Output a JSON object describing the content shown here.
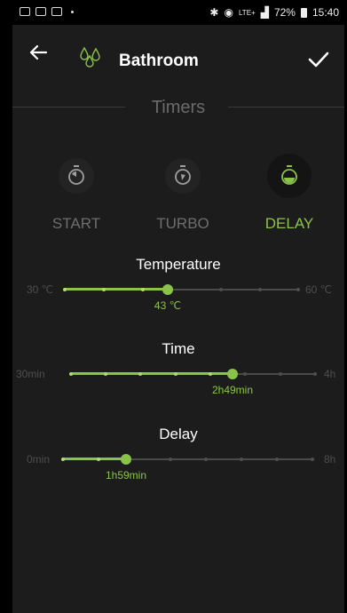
{
  "status_bar": {
    "signal_label": "LTE+",
    "battery": "72%",
    "time": "15:40"
  },
  "app_bar": {
    "title": "Bathroom"
  },
  "section": {
    "title": "Timers"
  },
  "modes": [
    {
      "label": "START",
      "active": false
    },
    {
      "label": "TURBO",
      "active": false
    },
    {
      "label": "DELAY",
      "active": true
    }
  ],
  "sliders": {
    "temperature": {
      "title": "Temperature",
      "min_label": "30 ℃",
      "max_label": "60 ℃",
      "value_label": "43 ℃",
      "level": 0.43
    },
    "time": {
      "title": "Time",
      "min_label": "30min",
      "max_label": "4h",
      "value_label": "2h49min",
      "level": 0.65
    },
    "delay": {
      "title": "Delay",
      "min_label": "0min",
      "max_label": "8h",
      "value_label": "1h59min",
      "level": 0.25
    }
  },
  "colors": {
    "accent": "#8bc34a",
    "background": "#1c1c1c"
  }
}
